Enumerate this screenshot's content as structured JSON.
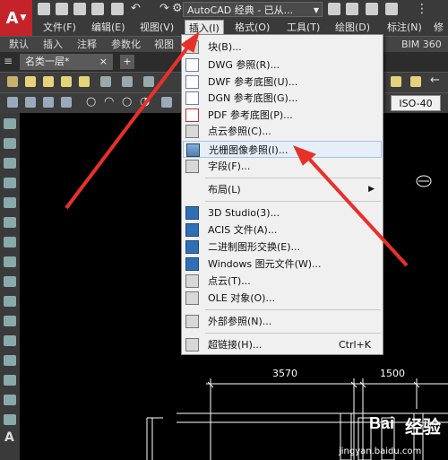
{
  "app": {
    "logo_letter": "A",
    "workspace": "AutoCAD 经典 - 已从..."
  },
  "menubar": [
    {
      "label": "文件(F)"
    },
    {
      "label": "编辑(E)"
    },
    {
      "label": "视图(V)"
    },
    {
      "label": "插入(I)"
    },
    {
      "label": "格式(O)"
    },
    {
      "label": "工具(T)"
    },
    {
      "label": "绘图(D)"
    },
    {
      "label": "标注(N)"
    },
    {
      "label": "修"
    }
  ],
  "ribbon_tabs": [
    {
      "label": "默认"
    },
    {
      "label": "插入"
    },
    {
      "label": "注释"
    },
    {
      "label": "参数化"
    },
    {
      "label": "视图"
    },
    {
      "label": "BIM 360"
    }
  ],
  "document_tab": {
    "label": "名类一层*",
    "close": "×",
    "new": "+"
  },
  "dimstyle": {
    "value": "ISO-40"
  },
  "insert_menu": {
    "items": [
      {
        "label": "块(B)...",
        "icon": "block-icon"
      },
      {
        "label": "DWG 参照(R)...",
        "icon": "dwg-icon"
      },
      {
        "label": "DWF 参考底图(U)...",
        "icon": "dwf-icon"
      },
      {
        "label": "DGN 参考底图(G)...",
        "icon": "dgn-icon"
      },
      {
        "label": "PDF 参考底图(P)...",
        "icon": "pdf-icon"
      },
      {
        "label": "点云参照(C)...",
        "icon": "point-cloud-icon"
      },
      {
        "label": "光栅图像参照(I)...",
        "icon": "raster-image-icon"
      },
      {
        "label": "字段(F)...",
        "icon": "field-icon"
      },
      {
        "label": "布局(L)",
        "submenu_arrow": "▶"
      },
      {
        "label": "3D Studio(3)...",
        "icon": "3ds-icon"
      },
      {
        "label": "ACIS 文件(A)...",
        "icon": "acis-icon"
      },
      {
        "label": "二进制图形交换(E)...",
        "icon": "dxb-icon"
      },
      {
        "label": "Windows 图元文件(W)...",
        "icon": "wmf-icon"
      },
      {
        "label": "点云(T)...",
        "icon": "point-cloud-attach-icon"
      },
      {
        "label": "OLE 对象(O)...",
        "icon": "ole-icon"
      },
      {
        "label": "外部参照(N)...",
        "icon": "xref-icon"
      },
      {
        "label": "超链接(H)...",
        "icon": "hyperlink-icon",
        "shortcut": "Ctrl+K"
      }
    ]
  },
  "drawing": {
    "dim1": "3570",
    "dim2": "1500"
  },
  "watermark": {
    "brand": "Bai",
    "brand_cn": "经验",
    "url": "jingyan.baidu.com"
  },
  "colors": {
    "arrow": "#e8302a",
    "logo": "#c4232a",
    "menu_bg": "#f0f0f0",
    "highlight": "#e6eef8"
  }
}
